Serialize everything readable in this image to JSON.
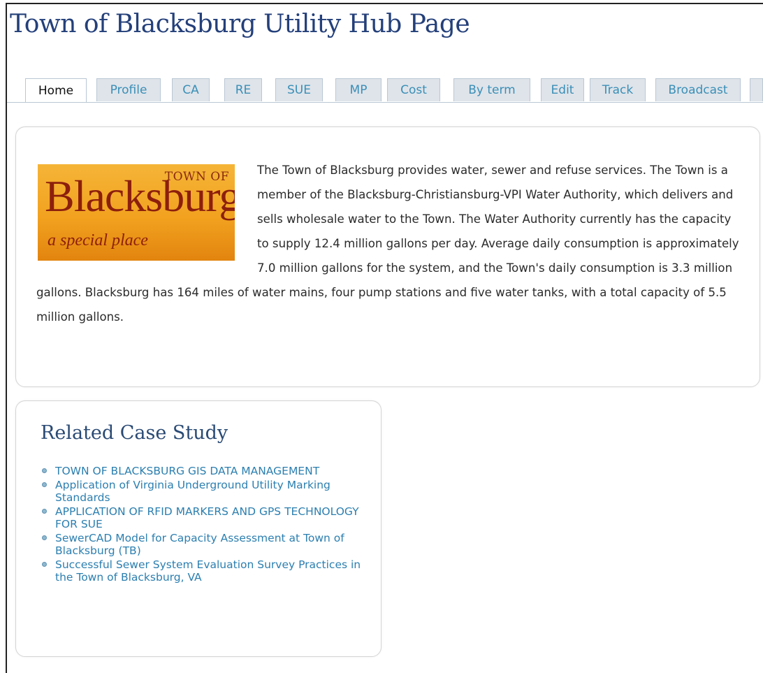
{
  "header": {
    "title": "Town of Blacksburg Utility Hub Page"
  },
  "tabs": [
    {
      "label": "Home",
      "active": true
    },
    {
      "label": "Profile",
      "active": false
    },
    {
      "label": "CA",
      "active": false
    },
    {
      "label": "RE",
      "active": false
    },
    {
      "label": "SUE",
      "active": false
    },
    {
      "label": "MP",
      "active": false
    },
    {
      "label": "Cost",
      "active": false
    },
    {
      "label": "By term",
      "active": false
    },
    {
      "label": "Edit",
      "active": false
    },
    {
      "label": "Track",
      "active": false
    },
    {
      "label": "Broadcast",
      "active": false
    },
    {
      "label": "",
      "active": false
    }
  ],
  "logo": {
    "line1": "TOWN OF",
    "name": "Blacksburg",
    "tagline": "a special place"
  },
  "intro": {
    "text": "The Town of Blacksburg provides water, sewer and refuse services. The Town is a member of the Blacksburg-Christiansburg-VPI Water Authority, which delivers and sells wholesale water to the Town. The Water Authority currently has the capacity to supply 12.4 million gallons per day. Average daily consumption is approximately 7.0 million gallons for the system, and the Town's daily consumption is 3.3 million gallons. Blacksburg has 164 miles of water mains, four pump stations and five water tanks, with a total capacity of 5.5 million gallons."
  },
  "related": {
    "title": "Related Case Study",
    "items": [
      "TOWN OF BLACKSBURG GIS DATA MANAGEMENT",
      "Application of Virginia Underground Utility Marking Standards",
      "APPLICATION OF RFID MARKERS AND GPS TECHNOLOGY FOR SUE",
      "SewerCAD Model for Capacity Assessment at Town of Blacksburg (TB)",
      "Successful Sewer System Evaluation Survey Practices in the Town of Blacksburg, VA"
    ]
  },
  "colors": {
    "title": "#24407a",
    "link": "#2c7fb0",
    "tab_text": "#3a8fb7",
    "tab_bg": "#dfe4ea",
    "logo_bg": "#f2a21f",
    "logo_text": "#8c1f0c"
  }
}
